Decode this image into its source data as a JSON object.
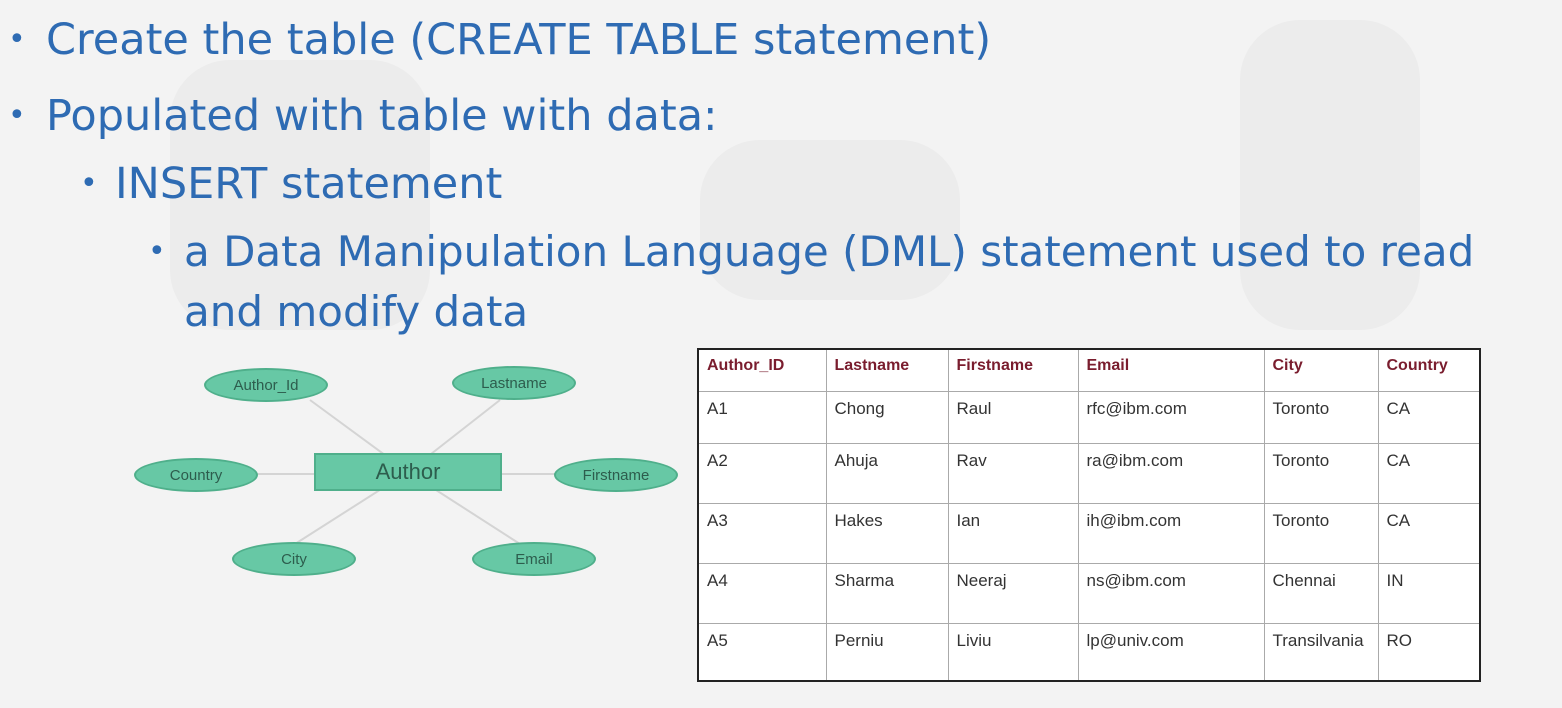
{
  "bullets": [
    {
      "level": 1,
      "text": "Create the table (CREATE TABLE statement)"
    },
    {
      "level": 1,
      "text": "Populated with table with data:"
    },
    {
      "level": 2,
      "text": "INSERT statement"
    },
    {
      "level": 3,
      "text": "a Data Manipulation Language (DML) statement used to read"
    },
    {
      "level": 3,
      "continuation": true,
      "text": "and modify data"
    }
  ],
  "bullet_glyph": "•",
  "er_diagram": {
    "entity": "Author",
    "attributes": [
      "Author_Id",
      "Lastname",
      "Country",
      "Firstname",
      "City",
      "Email"
    ],
    "fill_color": "#67c8a5"
  },
  "table": {
    "headers": [
      "Author_ID",
      "Lastname",
      "Firstname",
      "Email",
      "City",
      "Country"
    ],
    "rows": [
      [
        "A1",
        "Chong",
        "Raul",
        "rfc@ibm.com",
        "Toronto",
        "CA"
      ],
      [
        "A2",
        "Ahuja",
        "Rav",
        "ra@ibm.com",
        "Toronto",
        "CA"
      ],
      [
        "A3",
        "Hakes",
        "Ian",
        "ih@ibm.com",
        "Toronto",
        "CA"
      ],
      [
        "A4",
        "Sharma",
        "Neeraj",
        "ns@ibm.com",
        "Chennai",
        "IN"
      ],
      [
        "A5",
        "Perniu",
        "Liviu",
        "lp@univ.com",
        "Transilvania",
        "RO"
      ]
    ],
    "header_color": "#7a1d2e"
  },
  "colors": {
    "bullet_text": "#2e6bb3",
    "background": "#f3f3f3"
  }
}
